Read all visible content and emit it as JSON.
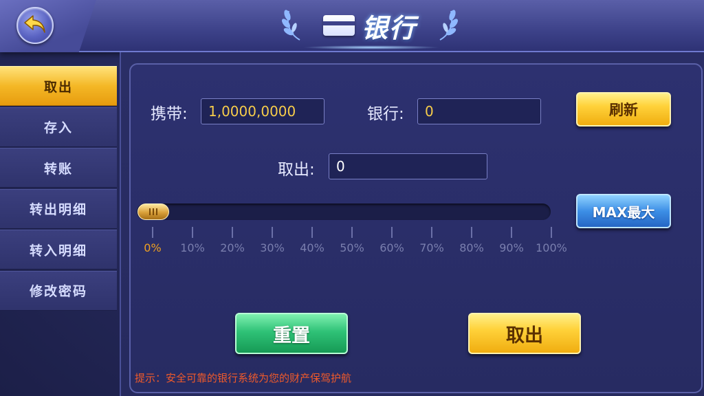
{
  "header": {
    "title": "银行",
    "back_icon": "back-arrow-icon",
    "title_icon": "bank-card-icon",
    "decor_icon": "laurel-icon"
  },
  "sidebar": {
    "items": [
      {
        "label": "取出",
        "active": true
      },
      {
        "label": "存入",
        "active": false
      },
      {
        "label": "转账",
        "active": false
      },
      {
        "label": "转出明细",
        "active": false
      },
      {
        "label": "转入明细",
        "active": false
      },
      {
        "label": "修改密码",
        "active": false
      }
    ]
  },
  "form": {
    "carry_label": "携带:",
    "carry_value": "1,0000,0000",
    "bank_label": "银行:",
    "bank_value": "0",
    "withdraw_label": "取出:",
    "withdraw_value": "0",
    "refresh_button": "刷新",
    "max_button": "MAX最大"
  },
  "slider": {
    "value_percent": 0,
    "tick_labels": [
      "0%",
      "10%",
      "20%",
      "30%",
      "40%",
      "50%",
      "60%",
      "70%",
      "80%",
      "90%",
      "100%"
    ]
  },
  "actions": {
    "reset_button": "重置",
    "withdraw_button": "取出"
  },
  "hint": "提示：安全可靠的银行系统为您的财产保驾护航",
  "colors": {
    "accent_gold": "#f7cd4a",
    "accent_green": "#2fc277",
    "accent_blue": "#3d8fe6",
    "hint_red": "#f05a2a",
    "slider_current": "#f0a020"
  }
}
